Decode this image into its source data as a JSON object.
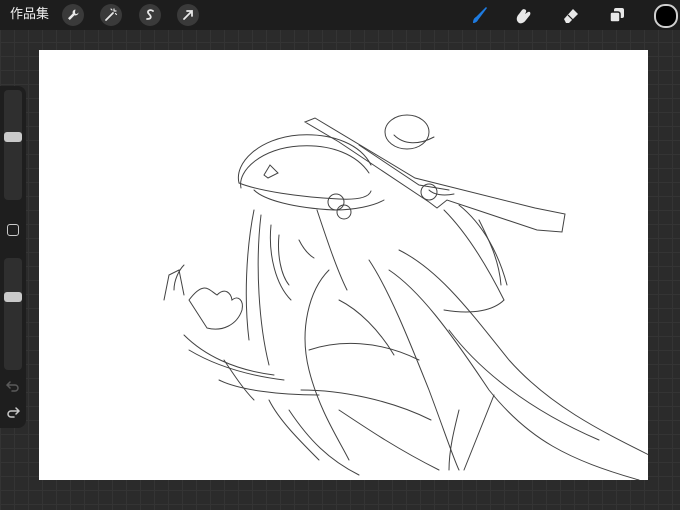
{
  "topbar": {
    "gallery_label": "作品集",
    "left_tools": [
      "wrench-icon",
      "magic-wand-icon",
      "selection-icon",
      "transform-arrow-icon"
    ],
    "right_tools": [
      "brush-icon",
      "smudge-icon",
      "eraser-icon",
      "layers-icon"
    ],
    "active_tool": "brush-icon",
    "active_color": "#1e7be0",
    "current_color": "#000000"
  },
  "sidebar": {
    "brush_size_level": 0.42,
    "opacity_level": 0.33
  }
}
